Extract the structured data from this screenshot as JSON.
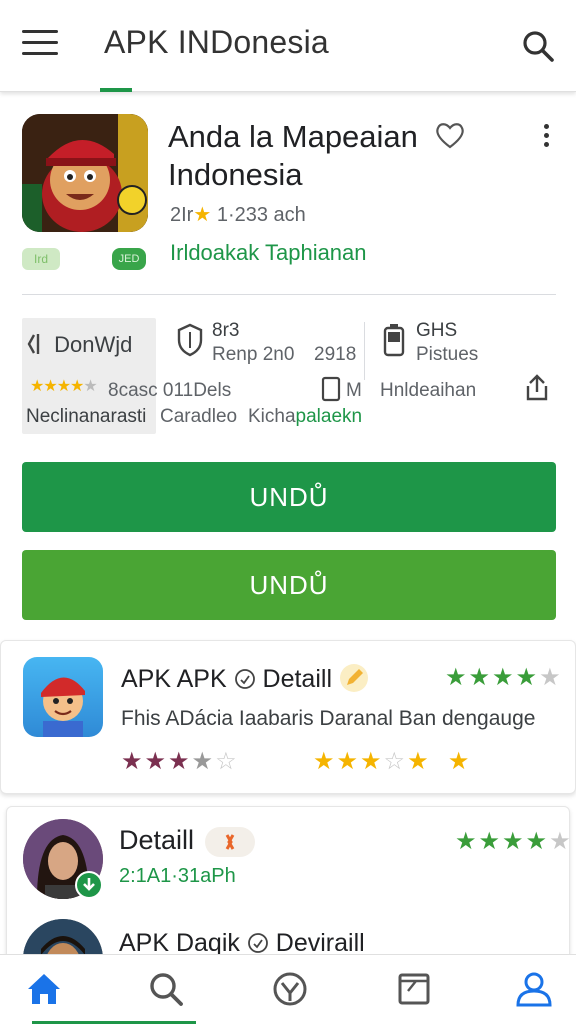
{
  "appbar": {
    "title": "APK INDonesia",
    "menu_icon": "hamburger-menu-icon",
    "search_icon": "search-icon"
  },
  "app": {
    "name": "Anda la Mapeaian Indonesia",
    "rating_text": "2Ir",
    "rating_star": "★",
    "rating_meta": "1·233 ach",
    "developer": "Irldoakak Taphianan",
    "pill_left": "Ird",
    "pill_right": "JED"
  },
  "info": {
    "download_title": "DonWjd",
    "col2_top": "8r3",
    "col2_bottom": "Renp 2n0",
    "col2_extra": "2918",
    "col3_top": "GHS",
    "col3_bottom": "Pistues",
    "row2_col1": "8casc 011Dels",
    "row2_col2": "M",
    "row2_col3": "Hnldeaihan",
    "row3_col1": "Neclinanarasti",
    "row3_col2": "Caradleo",
    "row3_col3_plain": "Kicha",
    "row3_col3_green": "palaekn"
  },
  "buttons": {
    "primary": "UNDŮ",
    "secondary": "UNDŮ"
  },
  "card1": {
    "title": "APK APK",
    "title_detail": "Detaill",
    "description": "Fhis ADácia Iaabaris Daranal Ban dengauge",
    "rating_stars": "★★★★",
    "rating_empty": "★"
  },
  "card2": {
    "title": "Detaill",
    "subtitle": "2:1A1·31aPh",
    "second_title": "APK Daqik",
    "second_detail": "Deviraill",
    "rating_stars": "★★★★",
    "rating_empty": "★"
  },
  "colors": {
    "accent_green": "#1e9648",
    "secondary_green": "#4aa534",
    "star_gold": "#f5b400"
  }
}
